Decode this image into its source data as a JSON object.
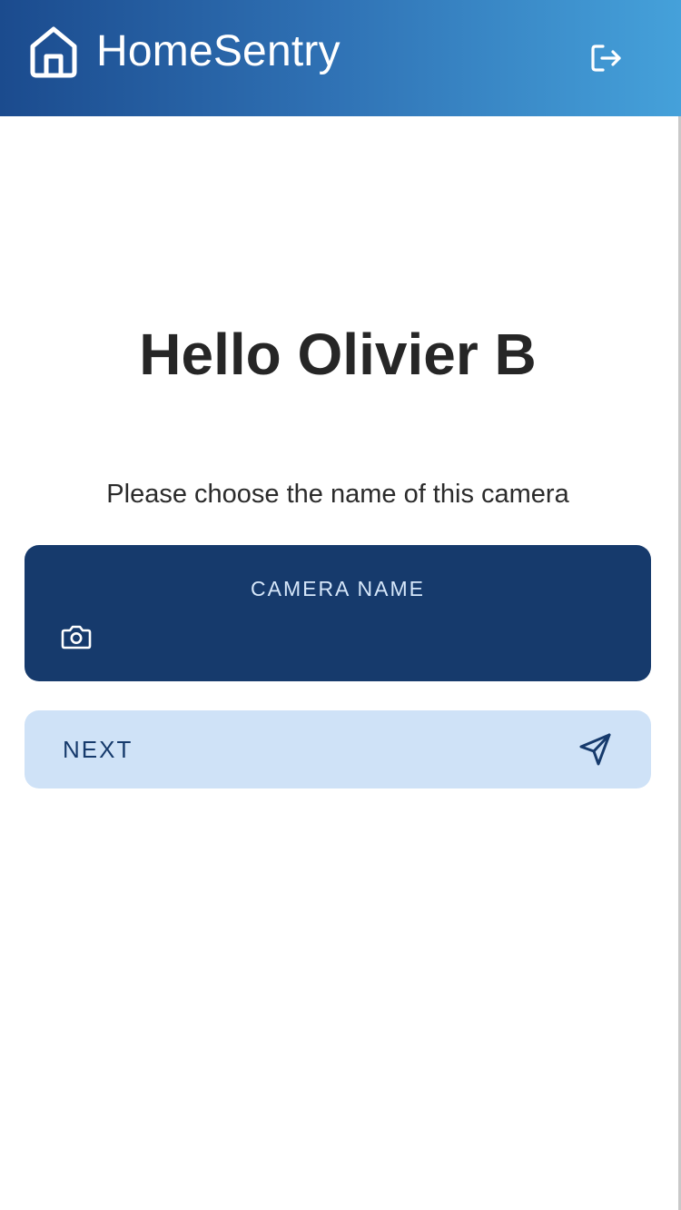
{
  "header": {
    "app_title": "HomeSentry",
    "home_icon": "home-icon",
    "logout_icon": "logout-icon",
    "gradient_start": "#1b4b8e",
    "gradient_end": "#45a1da"
  },
  "main": {
    "greeting": "Hello Olivier B",
    "prompt": "Please choose the name of this camera"
  },
  "camera_name_field": {
    "label": "CAMERA NAME",
    "value": "",
    "icon": "camera-icon",
    "background_color": "#163a6c"
  },
  "next_button": {
    "label": "NEXT",
    "icon": "send-icon",
    "background_color": "#cfe2f7"
  }
}
